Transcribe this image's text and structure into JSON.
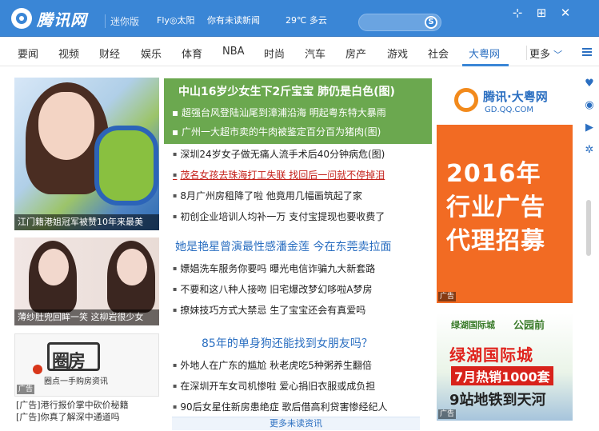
{
  "titlebar": {
    "logo_text": "腾讯网",
    "mini_label": "迷你版",
    "user": "Fly◎太阳",
    "unread": "你有未读新闻",
    "weather": "29℃  多云",
    "search_icon": "S"
  },
  "nav": {
    "items": [
      "要闻",
      "视频",
      "财经",
      "娱乐",
      "体育",
      "NBA",
      "时尚",
      "汽车",
      "房产",
      "游戏",
      "社会",
      "大粤网"
    ],
    "more": "更多"
  },
  "left": {
    "img1_caption": "江门籍港姐冠军被赞10年来最美",
    "img2_caption": "薄纱肚兜回眸一笑  这柳岩很少女",
    "img3_title": "圈房",
    "img3_sub": "圈点一手购房资讯",
    "ad_tag": "广告",
    "ad_links": [
      "[广告]港行报价掌中砍价秘籍",
      "[广告]你真了解深中通道吗"
    ]
  },
  "middle": {
    "headline": "中山16岁少女生下2斤宝宝 肺仍是白色(图)",
    "headline_subs": [
      "超强台风登陆汕尾到漳浦沿海  明起粤东特大暴雨",
      "广州一大超市卖的牛肉被鉴定百分百为猪肉(图)"
    ],
    "news1": [
      "深圳24岁女子做无痛人流手术后40分钟病危(图)",
      "茂名女孩去珠海打工失联  找回后一问就不停掉泪",
      "8月广州房租降了啦  他竟用几幅画筑起了家",
      "初创企业培训人均补一万  支付宝提现也要收费了"
    ],
    "section2_title": "她是艳星曾演最性感潘金莲 今在东莞卖拉面",
    "news2": [
      "嫖娼洗车服务你要吗  曝光电信诈骗九大新套路",
      "不要和这八种人接吻  旧宅爆改梦幻哆啦A梦房",
      "撩妹技巧方式大禁忌  生了宝宝还会有真爱吗"
    ],
    "section3_title": "85年的单身狗还能找到女朋友吗？",
    "news3": [
      "外地人在广东的尴尬  秋老虎吃5种粥养生翻倍",
      "在深圳开车女司机惨啦  爱心捐旧衣服或成负担",
      "90后女星住新房患绝症  歌后借高利贷害惨经纪人"
    ],
    "more_news": "更多未读资讯"
  },
  "right": {
    "ad1_brand": "腾讯·大粤网",
    "ad1_url": "GD.QQ.COM",
    "ad1_line1": "2016年",
    "ad1_line2": "行业广告",
    "ad1_line3": "代理招募",
    "ad1_tag": "广告",
    "ad2_brand": "绿湖国际城",
    "ad2_brand2": "公园前",
    "ad2_title": "绿湖国际城",
    "ad2_sale": "7月热销1000套",
    "ad2_metro": "9站地铁到天河",
    "ad2_tag": "广告"
  },
  "colors": {
    "titlebar": "#3a86d6",
    "headline_green": "#6ba84f",
    "accent_blue": "#2b6fc1",
    "link_red": "#c4211b",
    "ad_orange": "#f26b23"
  },
  "icons": {
    "window": [
      "pin-icon",
      "maximize-icon",
      "close-icon"
    ],
    "side": [
      "collect-icon",
      "qq-icon",
      "video-play-icon",
      "settings-icon"
    ]
  }
}
